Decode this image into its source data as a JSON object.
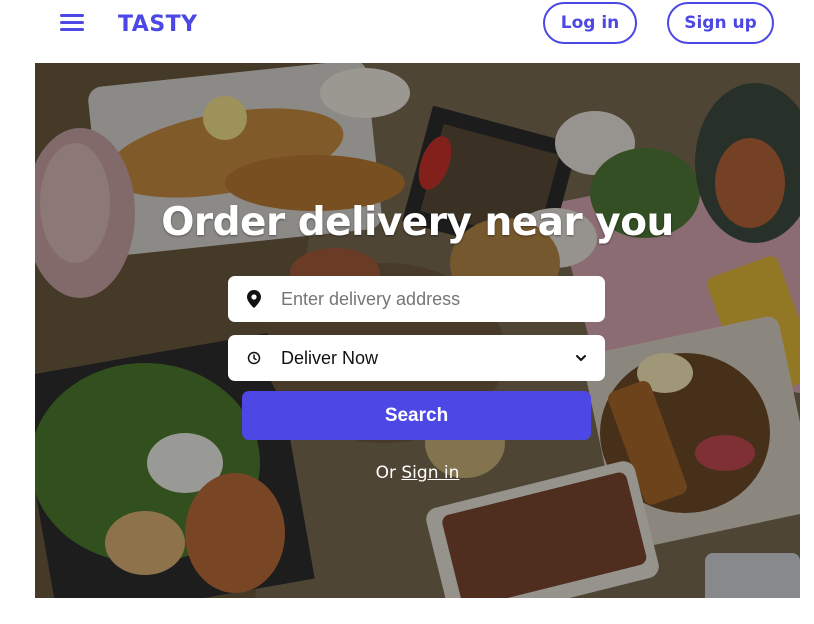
{
  "header": {
    "brand": "TASTY",
    "login_label": "Log in",
    "signup_label": "Sign up",
    "menu_icon": "hamburger-menu-icon"
  },
  "hero": {
    "title": "Order delivery near you",
    "address": {
      "value": "",
      "placeholder": "Enter delivery address",
      "icon": "map-pin-icon"
    },
    "delivery_time": {
      "selected": "Deliver Now",
      "icon": "clock-icon",
      "dropdown_icon": "chevron-down-icon"
    },
    "search_label": "Search",
    "or_text": "Or",
    "signin_link": "Sign in"
  },
  "colors": {
    "brand": "#4d48e5",
    "text_on_image": "#ffffff"
  }
}
